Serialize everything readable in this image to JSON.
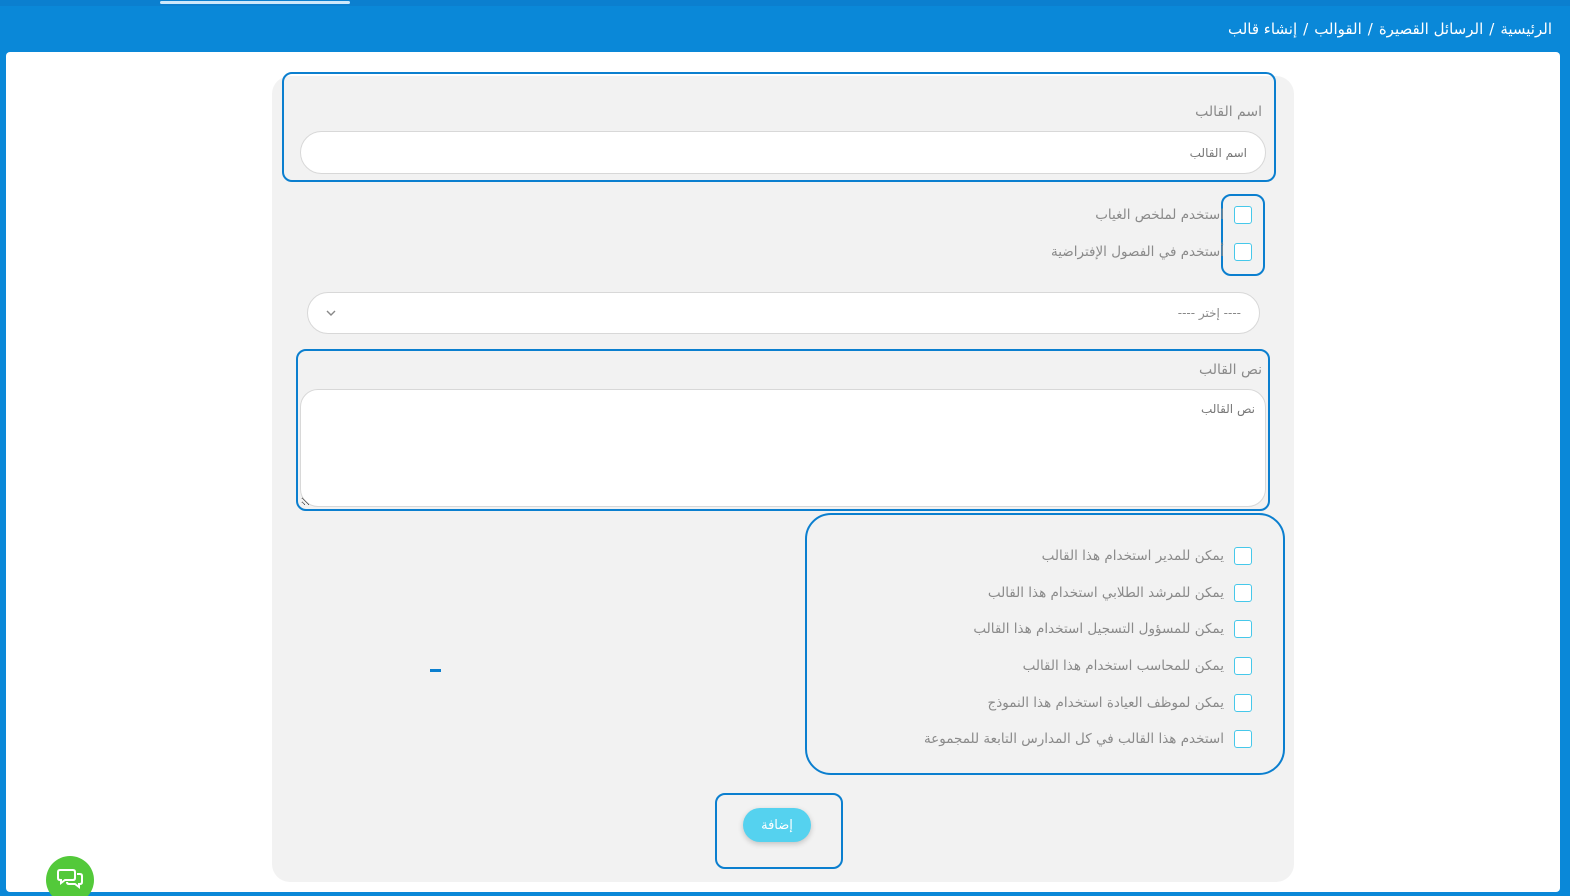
{
  "breadcrumb": {
    "items": [
      "الرئيسية",
      "الرسائل القصيرة",
      "القوالب",
      "إنشاء قالب"
    ],
    "separator": "/"
  },
  "form": {
    "template_name_label": "اسم القالب",
    "template_name_placeholder": "اسم القالب",
    "template_name_value": "",
    "absence_summary_label": "استخدم لملخص الغياب",
    "virtual_classes_label": "أستخدم في الفصول الإفتراضية",
    "select_value": "---- إختر ----",
    "template_text_label": "نص القالب",
    "template_text_placeholder": "نص القالب",
    "template_text_value": "",
    "permissions": [
      "يمكن للمدير استخدام هذا القالب",
      "يمكن للمرشد الطلابي استخدام هذا القالب",
      "يمكن للمسؤول التسجيل استخدام هذا القالب",
      "يمكن للمحاسب استخدام هذا القالب",
      "يمكن لموظف العيادة استخدام هذا النموذج",
      "استخدم هذا القالب في كل المدارس التابعة للمجموعة"
    ],
    "add_button_label": "إضافة"
  },
  "icons": {
    "select_chevron": "chevron-down-icon",
    "chat": "chat-icon"
  },
  "colors": {
    "header_blue": "#0a88d8",
    "highlight_blue": "#0b7fcf",
    "checkbox_border": "#46c8ea",
    "button_cyan": "#55d2ef",
    "chat_green": "#53c93a",
    "card_gray": "#f2f2f2"
  }
}
